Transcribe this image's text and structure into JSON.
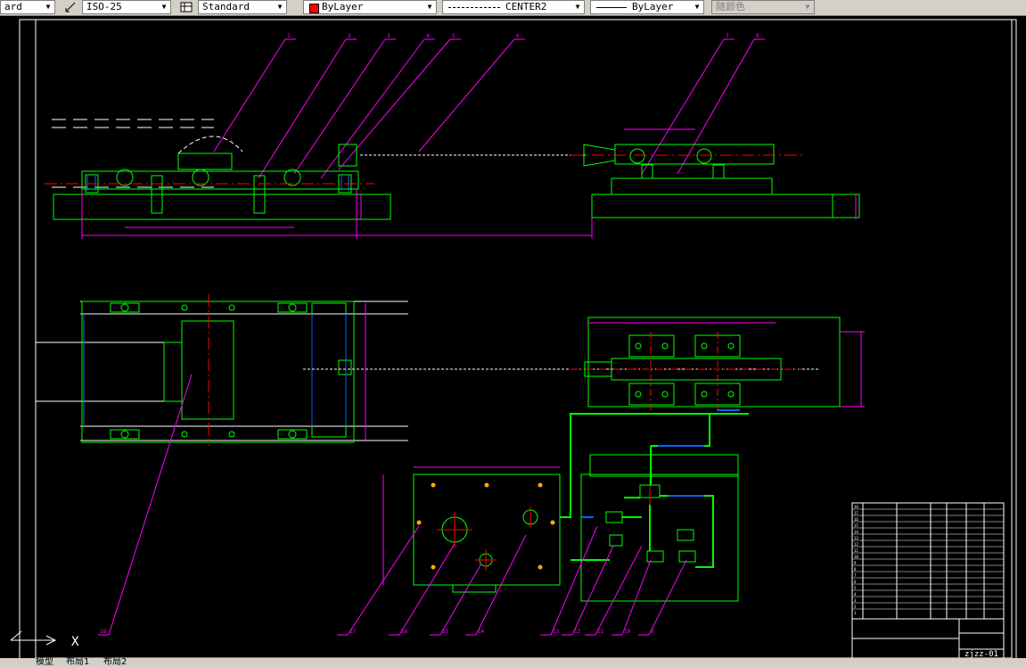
{
  "toolbar": {
    "dimstyle_value": "ISO-25",
    "textstyle_left_value": "ard",
    "tablestyle_value": "Standard",
    "layer_color_value": "ByLayer",
    "linetype_value": "CENTER2",
    "lineweight_value": "ByLayer",
    "plotstyle_value": "随颜色",
    "layer_color_hex": "#ff0000"
  },
  "tabs": {
    "model": "模型",
    "layout1": "布局1",
    "layout2": "布局2"
  },
  "drawing": {
    "background": "#000000",
    "balloons_top": [
      "1",
      "2",
      "3",
      "4",
      "5",
      "6",
      "7",
      "8"
    ],
    "balloons_bottom": [
      "9",
      "10",
      "11",
      "12",
      "13",
      "14",
      "15",
      "16",
      "17",
      "18"
    ],
    "drawing_number": "zjzz-01",
    "title_block_rows": [
      "18",
      "17",
      "16",
      "15",
      "14",
      "13",
      "12",
      "11",
      "10",
      "9",
      "8",
      "7",
      "6",
      "5",
      "4",
      "3",
      "2",
      "1"
    ],
    "ucs_label": "X"
  }
}
